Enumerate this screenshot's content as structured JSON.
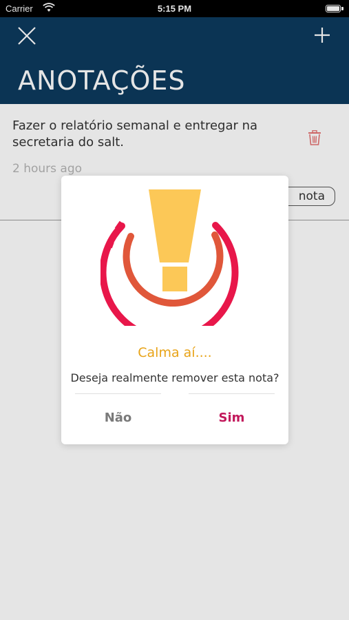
{
  "status_bar": {
    "carrier": "Carrier",
    "time": "5:15 PM"
  },
  "header": {
    "title": "ANOTAÇÕES",
    "close_icon": "close-icon",
    "add_icon": "plus-icon",
    "background_color": "#0d3a5e"
  },
  "notes": [
    {
      "text": "Fazer o relatório semanal e entregar na secretaria do salt.",
      "timestamp": "2 hours ago",
      "action_label": "nota"
    }
  ],
  "dialog": {
    "icon": "warning-exclamation-icon",
    "title": "Calma aí....",
    "message": "Deseja realmente remover esta nota?",
    "cancel_label": "Não",
    "confirm_label": "Sim"
  },
  "colors": {
    "accent_yellow": "#e8a317",
    "confirm_pink": "#c2185b",
    "ring_outer": "#e8174a",
    "ring_inner": "#e0573a",
    "exclamation": "#fcc857"
  }
}
